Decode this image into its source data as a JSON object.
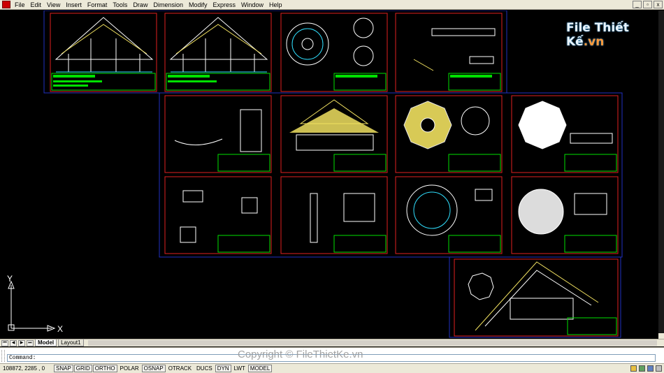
{
  "menu": [
    "File",
    "Edit",
    "View",
    "Insert",
    "Format",
    "Tools",
    "Draw",
    "Dimension",
    "Modify",
    "Express",
    "Window",
    "Help"
  ],
  "window_controls": [
    "_",
    "▫",
    "x"
  ],
  "logo": {
    "text": "File Thiết Kế",
    "suffix": ".vn"
  },
  "ucs": {
    "x_label": "X",
    "y_label": "Y"
  },
  "layout_tabs": {
    "model": "Model",
    "layout": "Layout1"
  },
  "tab_nav": [
    "⏮",
    "◀",
    "▶",
    "⏭"
  ],
  "command": {
    "prompt": "Command:"
  },
  "status": {
    "coords": "108872, 2285 , 0",
    "buttons": [
      {
        "label": "SNAP",
        "on": true
      },
      {
        "label": "GRID",
        "on": true
      },
      {
        "label": "ORTHO",
        "on": true
      },
      {
        "label": "POLAR",
        "on": false
      },
      {
        "label": "OSNAP",
        "on": true
      },
      {
        "label": "OTRACK",
        "on": false
      },
      {
        "label": "DUCS",
        "on": false
      },
      {
        "label": "DYN",
        "on": true
      },
      {
        "label": "LWT",
        "on": false
      },
      {
        "label": "MODEL",
        "on": true
      }
    ]
  },
  "watermark": "Copyright © FileThietKe.vn",
  "colors": {
    "frame_blue": "#2030c0",
    "frame_red": "#e02020",
    "title_green": "#00e000",
    "drawing_yellow": "#f0e060",
    "drawing_white": "#ffffff",
    "drawing_cyan": "#30e0ff"
  }
}
